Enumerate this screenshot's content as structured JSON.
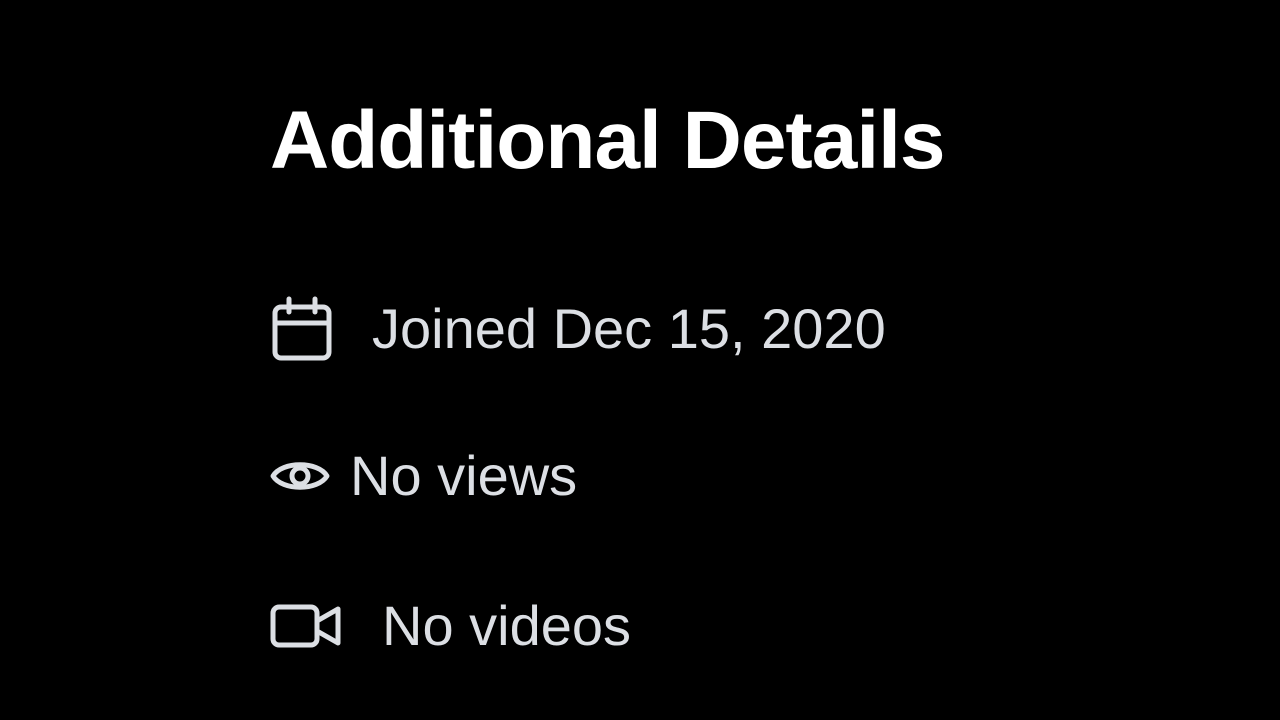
{
  "details": {
    "title": "Additional Details",
    "items": [
      {
        "icon": "calendar-icon",
        "text": "Joined Dec 15, 2020"
      },
      {
        "icon": "eye-icon",
        "text": "No views"
      },
      {
        "icon": "video-camera-icon",
        "text": "No videos"
      }
    ]
  },
  "colors": {
    "background": "#000000",
    "title": "#ffffff",
    "text": "#dcdfe4"
  }
}
